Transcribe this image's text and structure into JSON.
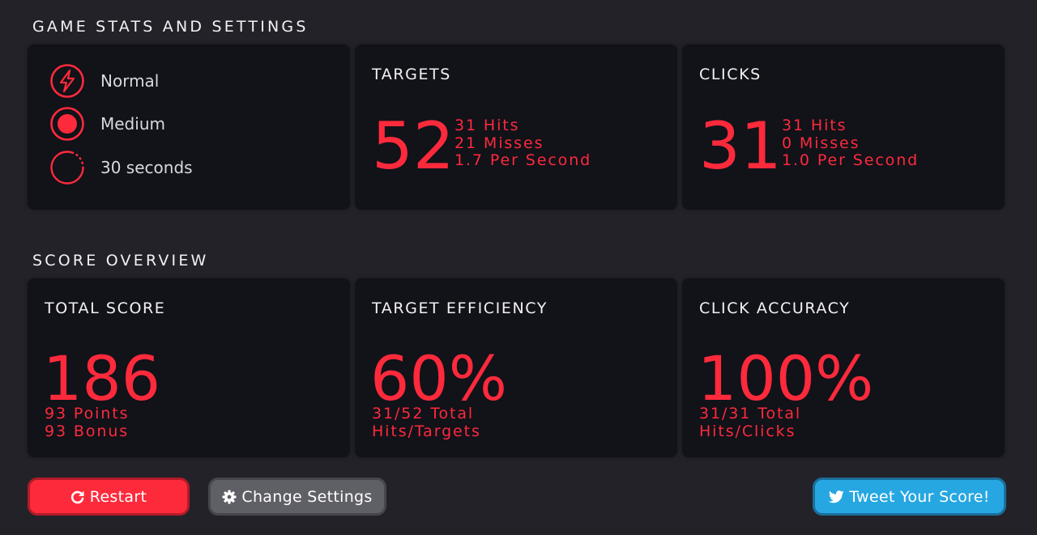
{
  "stats_section": {
    "title": "GAME STATS AND SETTINGS",
    "settings": [
      {
        "label": "Normal",
        "icon": "lightning-bolt-icon"
      },
      {
        "label": "Medium",
        "icon": "target-dot-icon"
      },
      {
        "label": "30 seconds",
        "icon": "timer-ring-icon"
      }
    ],
    "targets": {
      "heading": "TARGETS",
      "value": "52",
      "lines": [
        "31 Hits",
        "21 Misses",
        "1.7 Per Second"
      ]
    },
    "clicks": {
      "heading": "CLICKS",
      "value": "31",
      "lines": [
        "31 Hits",
        "0 Misses",
        "1.0 Per Second"
      ]
    }
  },
  "score_section": {
    "title": "SCORE OVERVIEW",
    "total_score": {
      "heading": "TOTAL SCORE",
      "value": "186",
      "lines": [
        "93 Points",
        "93 Bonus"
      ]
    },
    "target_efficiency": {
      "heading": "TARGET EFFICIENCY",
      "value": "60%",
      "lines": [
        "31/52 Total",
        "Hits/Targets"
      ]
    },
    "click_accuracy": {
      "heading": "CLICK ACCURACY",
      "value": "100%",
      "lines": [
        "31/31 Total",
        "Hits/Clicks"
      ]
    }
  },
  "buttons": {
    "restart": {
      "label": "Restart",
      "icon": "refresh-icon"
    },
    "change_settings": {
      "label": "Change Settings",
      "icon": "gear-icon"
    },
    "tweet": {
      "label": "Tweet Your Score!",
      "icon": "twitter-bird-icon"
    }
  },
  "colors": {
    "background": "#232229",
    "panel": "#121219",
    "accent_red": "#fd2a3c",
    "text": "#f2f2f5",
    "restart_button": "#fd2a3c",
    "settings_button": "#5f5f66",
    "tweet_button": "#26a7e2"
  }
}
